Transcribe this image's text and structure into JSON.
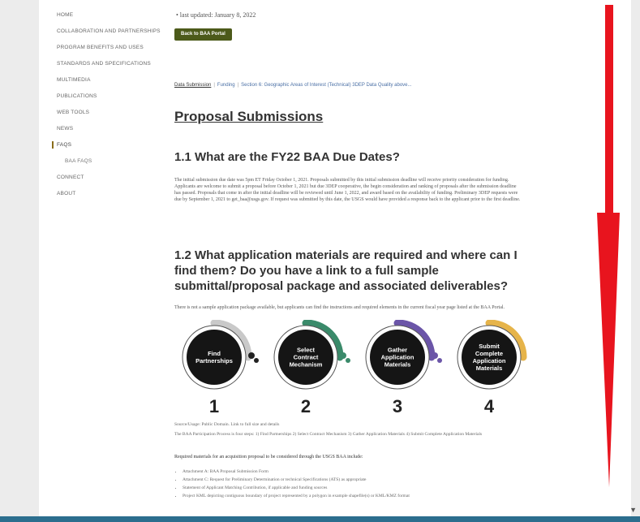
{
  "sidebar": {
    "items": [
      {
        "label": "HOME"
      },
      {
        "label": "COLLABORATION AND PARTNERSHIPS"
      },
      {
        "label": "PROGRAM BENEFITS AND USES"
      },
      {
        "label": "STANDARDS AND SPECIFICATIONS"
      },
      {
        "label": "MULTIMEDIA"
      },
      {
        "label": "PUBLICATIONS"
      },
      {
        "label": "WEB TOOLS"
      },
      {
        "label": "NEWS"
      },
      {
        "label": "FAQs"
      },
      {
        "label": "BAA FAQs"
      },
      {
        "label": "CONNECT"
      },
      {
        "label": "ABOUT"
      }
    ]
  },
  "main": {
    "last_updated": "• last updated: January 8, 2022",
    "back_button": "Back to BAA Portal",
    "breadcrumb": [
      "Data Submission",
      "Funding",
      "Section 6: Geographic Areas of Interest (Technical) 3DEP Data Quality above..."
    ],
    "title": "Proposal Submissions",
    "section1_title": "1.1 What are the FY22 BAA Due Dates?",
    "section1_text": "The initial submission due date was 5pm ET Friday October 1, 2021. Proposals submitted by this initial submission deadline will receive priority consideration for funding. Applicants are welcome to submit a proposal before October 1, 2021 but due 3DEP cooperative, the begin consideration and ranking of proposals after the submission deadline has passed. Proposals that come in after the initial deadline will be reviewed until June 1, 2022, and award based on the availability of funding. Preliminary 3DEP requests were due by September 1, 2021 to get_baa@usgs.gov. If request was submitted by this date, the USGS would have provided a response back to the applicant prior to the first deadline.",
    "section2_title": "1.2 What application materials are required and where can I find them? Do you have a link to a full sample submittal/proposal package and associated deliverables?",
    "section2_text": "There is not a sample application package available, but applicants can find the instructions and required elements in the current fiscal year page listed at the BAA Portal.",
    "steps": [
      {
        "label_lines": [
          "Find",
          "Partnerships"
        ],
        "number": "1",
        "ring_color": "#c9c9c9"
      },
      {
        "label_lines": [
          "Select",
          "Contract",
          "Mechanism"
        ],
        "number": "2",
        "ring_color": "#3a8a6a"
      },
      {
        "label_lines": [
          "Gather",
          "Application",
          "Materials"
        ],
        "number": "3",
        "ring_color": "#6b55a8"
      },
      {
        "label_lines": [
          "Submit",
          "Complete",
          "Application",
          "Materials"
        ],
        "number": "4",
        "ring_color": "#e6b44a"
      }
    ],
    "caption1": "Source/Usage: Public Domain. Link to full size and details",
    "caption2": "The BAA Participation Process is four steps: 1) Find Partnerships 2) Select Contract Mechanism 3) Gather Application Materials 4) Submit Complete Application Materials",
    "required_text": "Required materials for an acquisition proposal to be considered through the USGS BAA include:",
    "bullets": [
      "Attachment A: BAA Proposal Submission Form",
      "Attachment C: Request for Preliminary Determination or technical Specifications (ATS) as appropriate",
      "Statement of Applicant Matching Contribution, if applicable and funding sources",
      "Project KML depicting contiguous boundary of project represented by a polygon in example shapefile(s) or KML/KMZ format"
    ]
  },
  "colors": {
    "back_button_bg": "#4c5a1a",
    "link": "#4a6fa5",
    "annotation_arrow": "#e8141e",
    "bottom_bar": "#2c6e8e"
  }
}
